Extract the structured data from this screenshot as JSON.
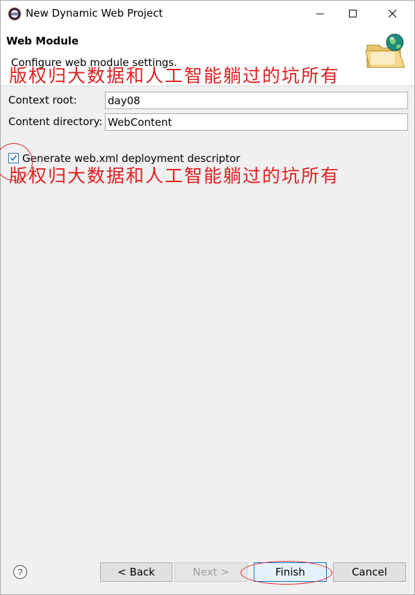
{
  "window": {
    "title": "New Dynamic Web Project",
    "minimize_icon": "minimize-icon",
    "maximize_icon": "maximize-icon",
    "close_icon": "close-icon"
  },
  "header": {
    "title": "Web Module",
    "description": "Configure web module settings.",
    "banner_icon": "web-folder-globe-icon"
  },
  "watermark": "版权归大数据和人工智能躺过的坑所有",
  "form": {
    "context_root_label": "Context root:",
    "context_root_value": "day08",
    "content_dir_label": "Content directory:",
    "content_dir_value": "WebContent",
    "generate_xml_label": "Generate web.xml deployment descriptor",
    "generate_xml_checked": true
  },
  "footer": {
    "help_icon": "help-icon",
    "back_label": "< Back",
    "next_label": "Next >",
    "finish_label": "Finish",
    "cancel_label": "Cancel"
  },
  "colors": {
    "accent": "#0078d7",
    "annotation": "#e02020"
  }
}
